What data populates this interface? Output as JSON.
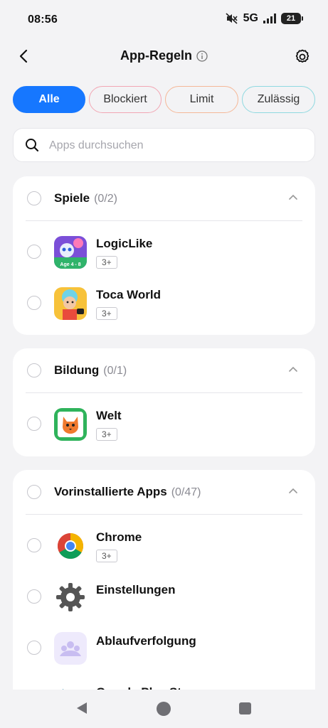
{
  "status_bar": {
    "time": "08:56",
    "network": "5G",
    "battery": "21"
  },
  "header": {
    "title": "App-Regeln"
  },
  "filters": {
    "all": "Alle",
    "blocked": "Blockiert",
    "limit": "Limit",
    "allowed": "Zulässig"
  },
  "search": {
    "placeholder": "Apps durchsuchen"
  },
  "categories": [
    {
      "title": "Spiele",
      "count": "(0/2)",
      "apps": [
        {
          "name": "LogicLike",
          "age": "3+",
          "icon": "logiclike-icon",
          "icon_label": "Age 4 - 8"
        },
        {
          "name": "Toca World",
          "age": "3+",
          "icon": "toca-world-icon"
        }
      ]
    },
    {
      "title": "Bildung",
      "count": "(0/1)",
      "apps": [
        {
          "name": "Welt",
          "age": "3+",
          "icon": "welt-icon"
        }
      ]
    },
    {
      "title": "Vorinstallierte Apps",
      "count": "(0/47)",
      "apps": [
        {
          "name": "Chrome",
          "age": "3+",
          "icon": "chrome-icon"
        },
        {
          "name": "Einstellungen",
          "icon": "settings-gear-icon"
        },
        {
          "name": "Ablaufverfolgung",
          "icon": "tracking-icon"
        },
        {
          "name": "Google Play Store",
          "icon": "play-store-icon"
        }
      ]
    }
  ],
  "colors": {
    "accent": "#1677ff",
    "blocked": "#f2a6b3",
    "limit": "#f5b898",
    "allowed": "#8fd9e0",
    "background": "#f3f3f5"
  }
}
